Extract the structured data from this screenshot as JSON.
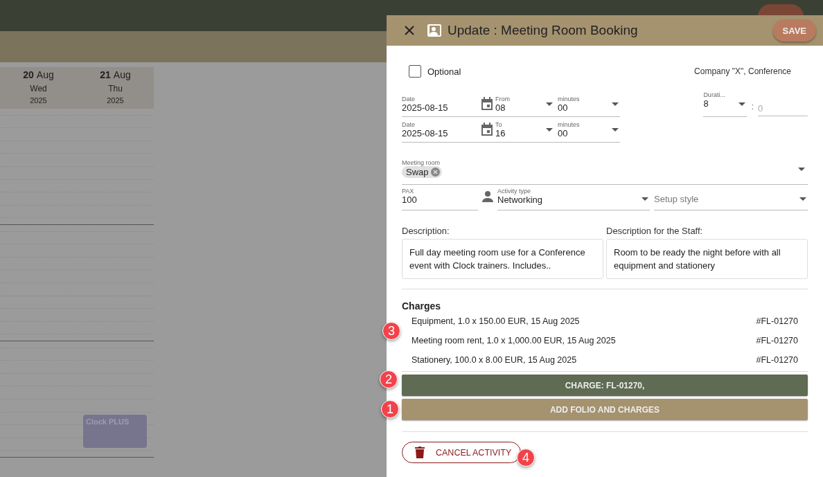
{
  "background": {
    "days": [
      {
        "day": "20",
        "month": "Aug",
        "weekday": "Wed",
        "year": "2025"
      },
      {
        "day": "21",
        "month": "Aug",
        "weekday": "Thu",
        "year": "2025"
      }
    ],
    "event": {
      "title": "Clock PLUS"
    }
  },
  "dialog": {
    "title": "Update : Meeting Room Booking",
    "save_button": "SAVE",
    "optional": {
      "label": "Optional",
      "checked": false
    },
    "company": "Company \"X\", Conference",
    "start": {
      "date_label": "Date",
      "date": "2025-08-15",
      "hour_label": "From",
      "hour": "08",
      "minutes_label": "minutes",
      "minutes": "00"
    },
    "end": {
      "date_label": "Date",
      "date": "2025-08-15",
      "hour_label": "To",
      "hour": "16",
      "minutes_label": "minutes",
      "minutes": "00"
    },
    "duration": {
      "label": "Durati...",
      "hours": "8",
      "separator": ":",
      "minutes_placeholder": "0"
    },
    "meeting_room": {
      "label": "Meeting room",
      "chips": [
        "Swap"
      ]
    },
    "pax": {
      "label": "PAX",
      "value": "100"
    },
    "activity_type": {
      "label": "Activity type",
      "value": "Networking"
    },
    "setup_style": {
      "placeholder": "Setup style"
    },
    "description": {
      "label": "Description:",
      "value": "Full day meeting room use for a Conference event with Clock trainers. Includes.."
    },
    "staff_description": {
      "label": "Description for the Staff:",
      "value": "Room to be ready the night before with all equipment and stationery"
    },
    "charges": {
      "title": "Charges",
      "callout": "3",
      "items": [
        {
          "text": "Equipment, 1.0 x 150.00 EUR, 15 Aug 2025",
          "folio": "#FL-01270"
        },
        {
          "text": "Meeting room rent, 1.0 x 1,000.00 EUR, 15 Aug 2025",
          "folio": "#FL-01270"
        },
        {
          "text": "Stationery, 100.0 x 8.00 EUR, 15 Aug 2025",
          "folio": "#FL-01270"
        }
      ]
    },
    "charge_button": {
      "label": "CHARGE: FL-01270,",
      "callout": "2"
    },
    "add_button": {
      "label": "ADD FOLIO AND CHARGES",
      "callout": "1"
    },
    "cancel_button": {
      "label": "CANCEL ACTIVITY",
      "callout": "4"
    }
  }
}
